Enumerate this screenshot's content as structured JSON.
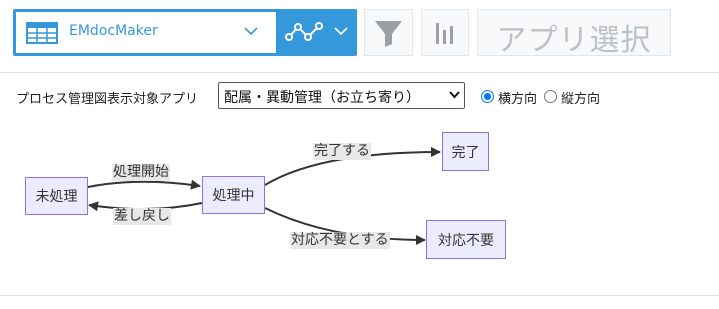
{
  "toolbar": {
    "view_name": "EMdocMaker",
    "app_select_label": "アプリ選択",
    "colors": {
      "accent": "#3498db",
      "button_bg": "#f7f9fa",
      "icon_gray": "#9aa1a4"
    },
    "icons": [
      "table-icon",
      "chevron-down-icon",
      "graph-icon",
      "filter-icon",
      "bar-chart-icon"
    ]
  },
  "controls": {
    "target_app_label": "プロセス管理図表示対象アプリ",
    "selected_app": "配属・異動管理（お立ち寄り）",
    "orientation": {
      "horizontal_label": "横方向",
      "vertical_label": "縦方向",
      "selected": "横方向"
    }
  },
  "diagram": {
    "nodes": {
      "unprocessed": "未処理",
      "processing": "処理中",
      "completed": "完了",
      "not_required": "対応不要"
    },
    "edges": {
      "start_processing": "処理開始",
      "send_back": "差し戻し",
      "complete": "完了する",
      "mark_not_required": "対応不要とする"
    },
    "colors": {
      "node_fill": "#ececff",
      "node_border": "#9370db",
      "edge": "#333333",
      "label_bg": "#e8e8e8"
    }
  }
}
